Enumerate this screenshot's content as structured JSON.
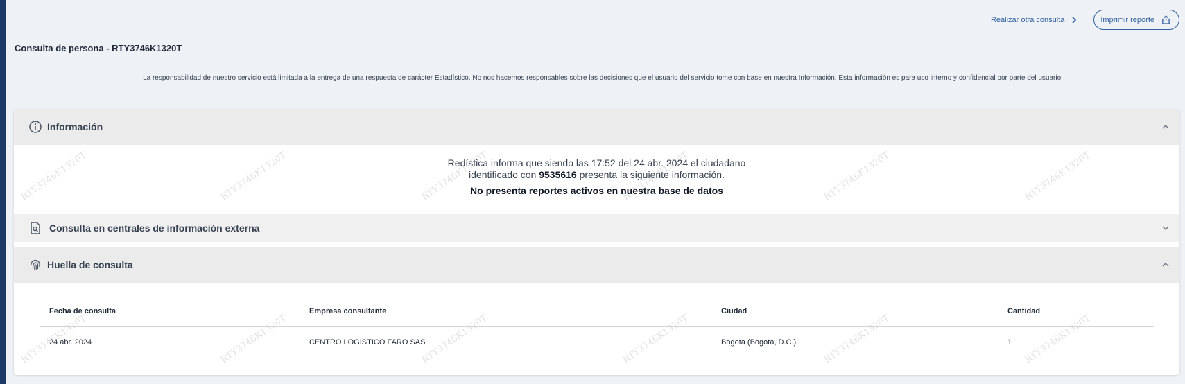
{
  "actions": {
    "realizar_label": "Realizar otra consulta",
    "imprimir_label": "Imprimir reporte"
  },
  "page_title": "Consulta de persona - RTY3746K1320T",
  "disclaimer": "La responsabilidad de nuestro servicio está limitada a la entrega de una respuesta de carácter Estadístico. No nos hacemos responsables sobre las decisiones que el usuario del servicio tome con base en nuestra Información. Esta información es para uso interno y confidencial por parte del usuario.",
  "watermark_text": "RTY3746K1320T",
  "sections": {
    "informacion": {
      "title": "Información",
      "line1": "Redística informa que siendo las 17:52 del 24 abr. 2024 el ciudadano",
      "line2_prefix": "identificado con",
      "id_number": "9535616",
      "line2_suffix": "presenta la siguiente información.",
      "status": "No presenta reportes activos en nuestra base de datos"
    },
    "consulta_externa": {
      "title": "Consulta en centrales de información externa"
    },
    "huella": {
      "title": "Huella de consulta"
    }
  },
  "table": {
    "headers": [
      "Fecha de consulta",
      "Empresa consultante",
      "Ciudad",
      "Cantidad"
    ],
    "rows": [
      [
        "24 abr. 2024",
        "CENTRO LOGISTICO FARO SAS",
        "Bogota (Bogota, D.C.)",
        "1"
      ]
    ]
  },
  "icons": {
    "info": "info-circle-icon",
    "search_doc": "search-document-icon",
    "fingerprint": "fingerprint-icon",
    "share": "share-icon",
    "chevron_right": "chevron-right-icon"
  },
  "colors": {
    "accent": "#2c5f9e",
    "rail": "#1d3a66",
    "section_bg": "#ebebeb",
    "page_bg": "#eef1f5"
  }
}
